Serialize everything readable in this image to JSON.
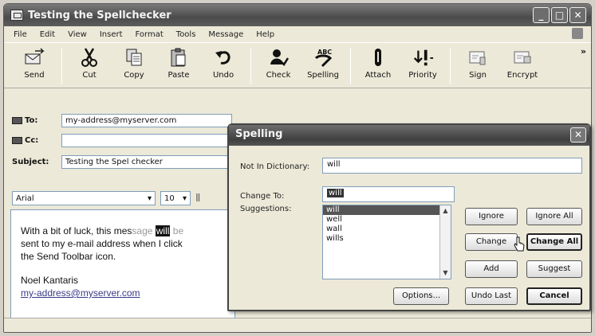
{
  "window": {
    "title": "Testing the Spellchecker"
  },
  "menu": [
    "File",
    "Edit",
    "View",
    "Insert",
    "Format",
    "Tools",
    "Message",
    "Help"
  ],
  "toolbar": [
    {
      "label": "Send",
      "icon": "send-icon"
    },
    {
      "label": "Cut",
      "icon": "scissors-icon"
    },
    {
      "label": "Copy",
      "icon": "copy-icon"
    },
    {
      "label": "Paste",
      "icon": "paste-icon"
    },
    {
      "label": "Undo",
      "icon": "undo-icon"
    },
    {
      "label": "Check",
      "icon": "check-names-icon"
    },
    {
      "label": "Spelling",
      "icon": "spelling-icon"
    },
    {
      "label": "Attach",
      "icon": "paperclip-icon"
    },
    {
      "label": "Priority",
      "icon": "priority-icon"
    },
    {
      "label": "Sign",
      "icon": "sign-icon"
    },
    {
      "label": "Encrypt",
      "icon": "encrypt-icon"
    }
  ],
  "fields": {
    "to_label": "To:",
    "to_value": "my-address@myserver.com",
    "cc_label": "Cc:",
    "cc_value": "",
    "subject_label": "Subject:",
    "subject_value": "Testing the Spel checker"
  },
  "format": {
    "font": "Arial",
    "size": "10"
  },
  "body": {
    "line1_a": "With a bit of luck, this mes",
    "line1_b": "sage",
    "line1_word": "will",
    "line1_c": "be",
    "line2": "sent to my e-mail address when I click",
    "line3": "the Send Toolbar icon.",
    "signature": "Noel Kantaris",
    "email": "my-address@myserver.com"
  },
  "dialog": {
    "title": "Spelling",
    "not_in_dict_label": "Not In Dictionary:",
    "not_in_dict_value": "will",
    "change_to_label": "Change To:",
    "change_to_value": "will",
    "suggestions_label": "Suggestions:",
    "suggestions": [
      "will",
      "well",
      "wall",
      "wills"
    ],
    "buttons": {
      "ignore": "Ignore",
      "ignore_all": "Ignore All",
      "change": "Change",
      "change_all": "Change All",
      "add": "Add",
      "suggest": "Suggest",
      "options": "Options...",
      "undo_last": "Undo Last",
      "cancel": "Cancel"
    }
  }
}
